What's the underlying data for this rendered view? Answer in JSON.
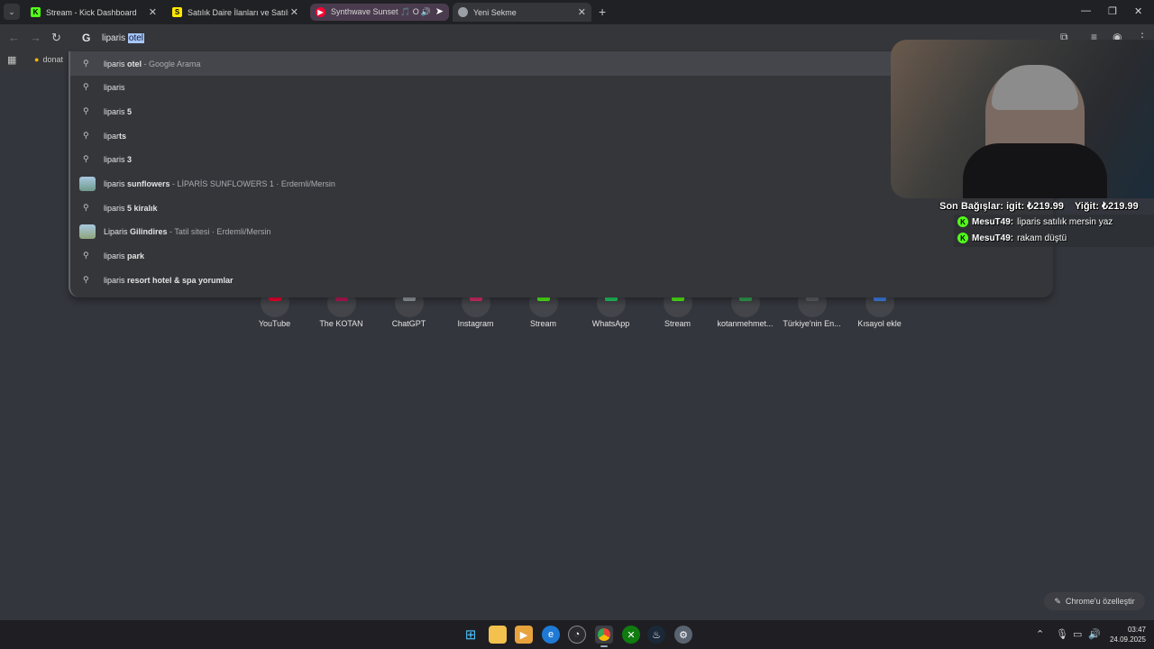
{
  "tabs": [
    {
      "title": "Stream - Kick Dashboard",
      "favicon": "kick-icon",
      "favicon_color": "#53fc18"
    },
    {
      "title": "Satılık Daire İlanları ve Satılık Ev",
      "favicon": "sahibinden-icon",
      "favicon_color": "#ffe800"
    },
    {
      "title": "Synthwave Sunset 🎵 Oyun",
      "favicon": "youtube-icon",
      "favicon_color": "#ff0033"
    },
    {
      "title": "Yeni Sekme",
      "favicon": "chrome-icon",
      "favicon_color": "#9aa0a6"
    }
  ],
  "omnibox": {
    "typed": "liparis ",
    "selected": "otel",
    "logo": "G"
  },
  "bookmarks": [
    {
      "label": "donat",
      "icon": "bookmark-favicon"
    }
  ],
  "suggestions": [
    {
      "base": "liparis ",
      "bold": "otel",
      "desc": " - Google Arama",
      "icon": "search-icon",
      "thumb": null
    },
    {
      "base": "liparis",
      "bold": "",
      "desc": "",
      "icon": "search-icon",
      "thumb": null
    },
    {
      "base": "liparis ",
      "bold": "5",
      "desc": "",
      "icon": "search-icon",
      "thumb": null
    },
    {
      "base": "lipar",
      "bold": "ts",
      "desc": "",
      "icon": "search-icon",
      "thumb": null
    },
    {
      "base": "liparis ",
      "bold": "3",
      "desc": "",
      "icon": "search-icon",
      "thumb": null
    },
    {
      "base": "liparis ",
      "bold": "sunflowers",
      "desc": " - LİPARİS SUNFLOWERS 1 · Erdemli/Mersin",
      "icon": "place-thumbnail",
      "thumb": "#6f9a8a"
    },
    {
      "base": "liparis ",
      "bold": "5 kiralık",
      "desc": "",
      "icon": "search-icon",
      "thumb": null
    },
    {
      "base": "Liparis ",
      "bold": "Gilindires",
      "desc": " - Tatil sitesi · Erdemli/Mersin",
      "icon": "place-thumbnail",
      "thumb": "#8ea57a"
    },
    {
      "base": "liparis ",
      "bold": "park",
      "desc": "",
      "icon": "search-icon",
      "thumb": null
    },
    {
      "base": "liparis ",
      "bold": "resort hotel & spa yorumlar",
      "desc": "",
      "icon": "search-icon",
      "thumb": null
    }
  ],
  "shortcuts": [
    {
      "label": "YouTube",
      "color": "#ff0033"
    },
    {
      "label": "The KOTAN",
      "color": "#c2185b"
    },
    {
      "label": "ChatGPT",
      "color": "#9aa0a6"
    },
    {
      "label": "Instagram",
      "color": "#e1306c"
    },
    {
      "label": "Stream",
      "color": "#53fc18"
    },
    {
      "label": "WhatsApp",
      "color": "#25d366"
    },
    {
      "label": "Stream",
      "color": "#53fc18"
    },
    {
      "label": "kotanmehmet...",
      "color": "#34a853"
    },
    {
      "label": "Türkiye'nin En...",
      "color": "#5f6368"
    },
    {
      "label": "Kısayol ekle",
      "color": "#4285f4"
    }
  ],
  "customize_label": "Chrome'u özelleştir",
  "overlay": {
    "donations": "Son Bağışlar: igit: ₺219.99    Yiğit: ₺219.99",
    "chat": [
      {
        "user": "MesuT49:",
        "message": "liparis satılık mersin yaz"
      },
      {
        "user": "MesuT49:",
        "message": "rakam düştü"
      }
    ]
  },
  "taskbar": {
    "apps": [
      "windows-start-icon",
      "file-explorer-icon",
      "media-player-icon",
      "edge-icon",
      "obs-icon",
      "chrome-icon",
      "xbox-icon",
      "steam-icon",
      "settings-icon"
    ],
    "time": "03:47",
    "date": "24.09.2025"
  }
}
